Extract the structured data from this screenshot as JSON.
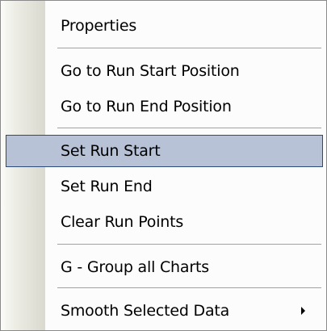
{
  "menu": {
    "items": [
      {
        "label": "Properties"
      },
      {
        "label": "Go to Run Start Position"
      },
      {
        "label": "Go to Run End Position"
      },
      {
        "label": "Set Run Start",
        "selected": true
      },
      {
        "label": "Set Run End"
      },
      {
        "label": "Clear Run Points"
      },
      {
        "label": "G - Group all Charts"
      },
      {
        "label": "Smooth Selected Data",
        "has_submenu": true
      }
    ]
  },
  "icons": {
    "submenu": "submenu-arrow-icon"
  },
  "colors": {
    "selection_fill": "#b7c2d6",
    "selection_border": "#2d4a7a",
    "menu_background": "#fcfcfc",
    "separator": "#a0a0a0"
  }
}
